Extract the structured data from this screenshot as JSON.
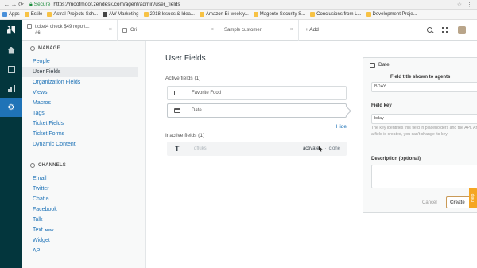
{
  "browser": {
    "secure_label": "Secure",
    "url": "https://moofmoof.zendesk.com/agent/admin/user_fields",
    "bookmarks": [
      {
        "label": "Apps",
        "icon": "grid"
      },
      {
        "label": "Estile",
        "icon": "folder"
      },
      {
        "label": "Astral Projects Sch...",
        "icon": "folder"
      },
      {
        "label": "AW Marketing",
        "icon": "dark"
      },
      {
        "label": "2018 Issues & Idea...",
        "icon": "folder"
      },
      {
        "label": "Amazon Bi-weekly...",
        "icon": "folder"
      },
      {
        "label": "Magento Security S...",
        "icon": "folder"
      },
      {
        "label": "Conclusions from L...",
        "icon": "folder"
      },
      {
        "label": "Development Proje...",
        "icon": "folder"
      }
    ]
  },
  "tabs": {
    "tab1_line1": "ticket4 check $49 report...",
    "tab1_line2": "#6",
    "tab2_label": "Ori",
    "tab3_label": "Sample customer",
    "add_label": "+ Add"
  },
  "sidebar": {
    "manage_heading": "MANAGE",
    "manage_items": [
      "People",
      "User Fields",
      "Organization Fields",
      "Views",
      "Macros",
      "Tags",
      "Ticket Fields",
      "Ticket Forms",
      "Dynamic Content"
    ],
    "channels_heading": "CHANNELS",
    "channel_items": [
      "Email",
      "Twitter",
      "Chat",
      "Facebook",
      "Talk",
      "Text",
      "Widget",
      "API"
    ],
    "chat_ext": "⧉",
    "text_new_badge": "NEW"
  },
  "main": {
    "title": "User Fields",
    "active_label": "Active fields (1)",
    "active_fields": [
      {
        "name": "Favorite Food",
        "type": "text"
      },
      {
        "name": "Date",
        "type": "date"
      }
    ],
    "hide_label": "Hide",
    "inactive_label": "Inactive fields (1)",
    "inactive_field": {
      "name": "dfluks",
      "type_glyph": "T"
    },
    "activate_label": "activate",
    "separator": "·",
    "clone_label": "clone"
  },
  "panel": {
    "header": "Date",
    "title_label": "Field title shown to agents",
    "title_value": "BDAY",
    "key_label": "Field key",
    "key_value": "bday",
    "key_help": "The key identifies this field in placeholders and the API. After a field is created, you can't change its key.",
    "description_label": "Description (optional)",
    "cancel_label": "Cancel",
    "create_label": "Create"
  },
  "help_tab": "Help",
  "colors": {
    "rail": "#03363d",
    "accent": "#1f73b7"
  }
}
